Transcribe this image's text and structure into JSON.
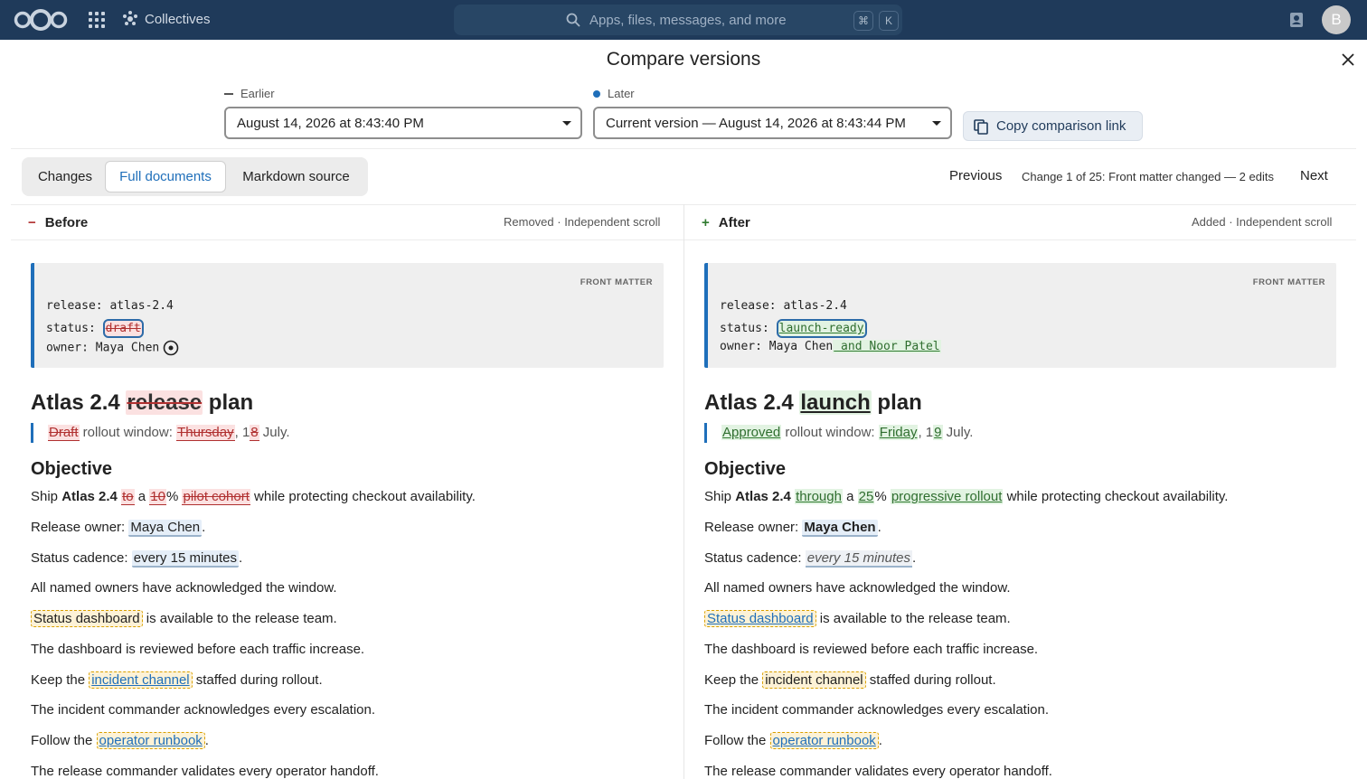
{
  "topbar": {
    "app_name": "Collectives",
    "search_placeholder": "Apps, files, messages, and more",
    "shortcut_cmd": "⌘",
    "shortcut_key": "K",
    "avatar_initial": "B"
  },
  "dialog": {
    "title": "Compare versions",
    "earlier_label": "Earlier",
    "earlier_value": "August 14, 2026 at 8:43:40 PM",
    "later_label": "Later",
    "later_value": "Current version — August 14, 2026 at 8:43:44 PM",
    "copy_link": "Copy comparison link"
  },
  "tabs": [
    {
      "label": "Changes"
    },
    {
      "label": "Full documents"
    },
    {
      "label": "Markdown source"
    }
  ],
  "nav": {
    "previous": "Previous",
    "status": "Change 1 of 25: Front matter changed — 2 edits",
    "next": "Next"
  },
  "before": {
    "head_symbol": "−",
    "heading": "Before",
    "meta": "Removed · Independent scroll",
    "fm_label": "FRONT MATTER",
    "fm_release": "release: atlas-2.4",
    "fm_status_key": "status:",
    "fm_status_val": "draft",
    "fm_owner": "owner: Maya Chen",
    "title_a": "Atlas 2.4 ",
    "title_del": "release",
    "title_b": " plan",
    "q_del1": "Draft",
    "q_t1": " rollout window: ",
    "q_del2": "Thursday",
    "q_t2": ", 1",
    "q_del3": "8",
    "q_t3": " July.",
    "objective": "Objective",
    "p1_a": "Ship ",
    "p1_b": "Atlas 2.4",
    "p1_del1": "to",
    "p1_t1": " a ",
    "p1_del2": "10",
    "p1_t2": "% ",
    "p1_del3": "pilot cohort",
    "p1_t3": " while protecting checkout availability.",
    "p2_a": "Release owner: ",
    "p2_mod": "Maya Chen",
    "p2_b": ".",
    "p3_a": "Status cadence: ",
    "p3_mod": "every 15 minutes",
    "p3_b": ".",
    "p4": "All named owners have acknowledged the window.",
    "p5_box": "Status dashboard",
    "p5_b": " is available to the release team.",
    "p6": "The dashboard is reviewed before each traffic increase.",
    "p7_a": "Keep the ",
    "p7_box": "incident channel",
    "p7_b": " staffed during rollout.",
    "p8": "The incident commander acknowledges every escalation.",
    "p9_a": "Follow the ",
    "p9_box": "operator runbook",
    "p9_b": ".",
    "p10": "The release commander validates every operator handoff."
  },
  "after": {
    "head_symbol": "+",
    "heading": "After",
    "meta": "Added · Independent scroll",
    "fm_label": "FRONT MATTER",
    "fm_release": "release: atlas-2.4",
    "fm_status_key": "status:",
    "fm_status_val": "launch-ready",
    "fm_owner": "owner: Maya Chen",
    "fm_owner_ins": " and Noor Patel",
    "title_a": "Atlas 2.4 ",
    "title_ins": "launch",
    "title_b": " plan",
    "q_ins1": "Approved",
    "q_t1": " rollout window: ",
    "q_ins2": "Friday",
    "q_t2": ", 1",
    "q_ins3": "9",
    "q_t3": " July.",
    "objective": "Objective",
    "p1_a": "Ship ",
    "p1_b": "Atlas 2.4",
    "p1_ins1": "through",
    "p1_t1": " a ",
    "p1_ins2": "25",
    "p1_t2": "% ",
    "p1_ins3": "progressive rollout",
    "p1_t3": " while protecting checkout availability.",
    "p2_a": "Release owner: ",
    "p2_mod": "Maya Chen",
    "p2_b": ".",
    "p3_a": "Status cadence: ",
    "p3_mod": "every 15 minutes",
    "p3_b": ".",
    "p4": "All named owners have acknowledged the window.",
    "p5_box": "Status dashboard",
    "p5_b": " is available to the release team.",
    "p6": "The dashboard is reviewed before each traffic increase.",
    "p7_a": "Keep the ",
    "p7_box": "incident channel",
    "p7_b": " staffed during rollout.",
    "p8": "The incident commander acknowledges every escalation.",
    "p9_a": "Follow the ",
    "p9_box": "operator runbook",
    "p9_b": ".",
    "p10": "The release commander validates every operator handoff."
  },
  "colors": {
    "topbar": "#1f3a5a",
    "accent": "#1f6fba",
    "removed": "#b03030",
    "added": "#2f7a2f"
  },
  "icons": {
    "logo": "nextcloud-logo",
    "apps": "app-grid-icon",
    "app": "collectives-icon",
    "search": "search-icon",
    "contacts": "contacts-icon",
    "close": "close-icon",
    "copy": "copy-icon",
    "target": "target-icon"
  }
}
